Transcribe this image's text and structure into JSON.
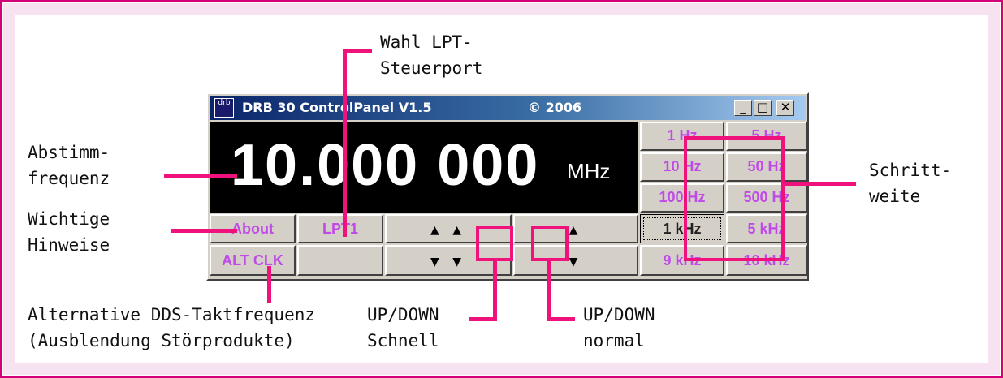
{
  "window": {
    "icon_text": "drb",
    "title": "DRB 30 ControlPanel V1.5",
    "copyright": "© 2006",
    "controls": {
      "minimize": "_",
      "maximize": "□",
      "close": "✕"
    }
  },
  "display": {
    "frequency": "10.000 000",
    "unit": "MHz"
  },
  "buttons": {
    "about": "About",
    "port": "LPT1",
    "alt_clk": "ALT CLK",
    "fast_up": "▲ ▲",
    "fast_down": "▼ ▼",
    "normal_up": "▲",
    "normal_down": "▼"
  },
  "steps": [
    "1 Hz",
    "5 Hz",
    "10 Hz",
    "50 Hz",
    "100 Hz",
    "500 Hz",
    "1 kHz",
    "5 kHz",
    "9 kHz",
    "10 kHz"
  ],
  "selected_step": "1 kHz",
  "annotations": {
    "lpt": "Wahl LPT-\nSteuerport",
    "freq": "Abstimm-\nfrequenz",
    "hints": "Wichtige\nHinweise",
    "step": "Schritt-\nweite",
    "alt_line1": "Alternative DDS-Taktfrequenz",
    "alt_line2": "(Ausblendung Störprodukte)",
    "fast": "UP/DOWN\nSchnell",
    "normal": "UP/DOWN\nnormal"
  },
  "colors": {
    "border": "#d3007a",
    "callout": "#f0127c",
    "button_text": "#c04ae8",
    "titlebar": "#0a246a"
  }
}
